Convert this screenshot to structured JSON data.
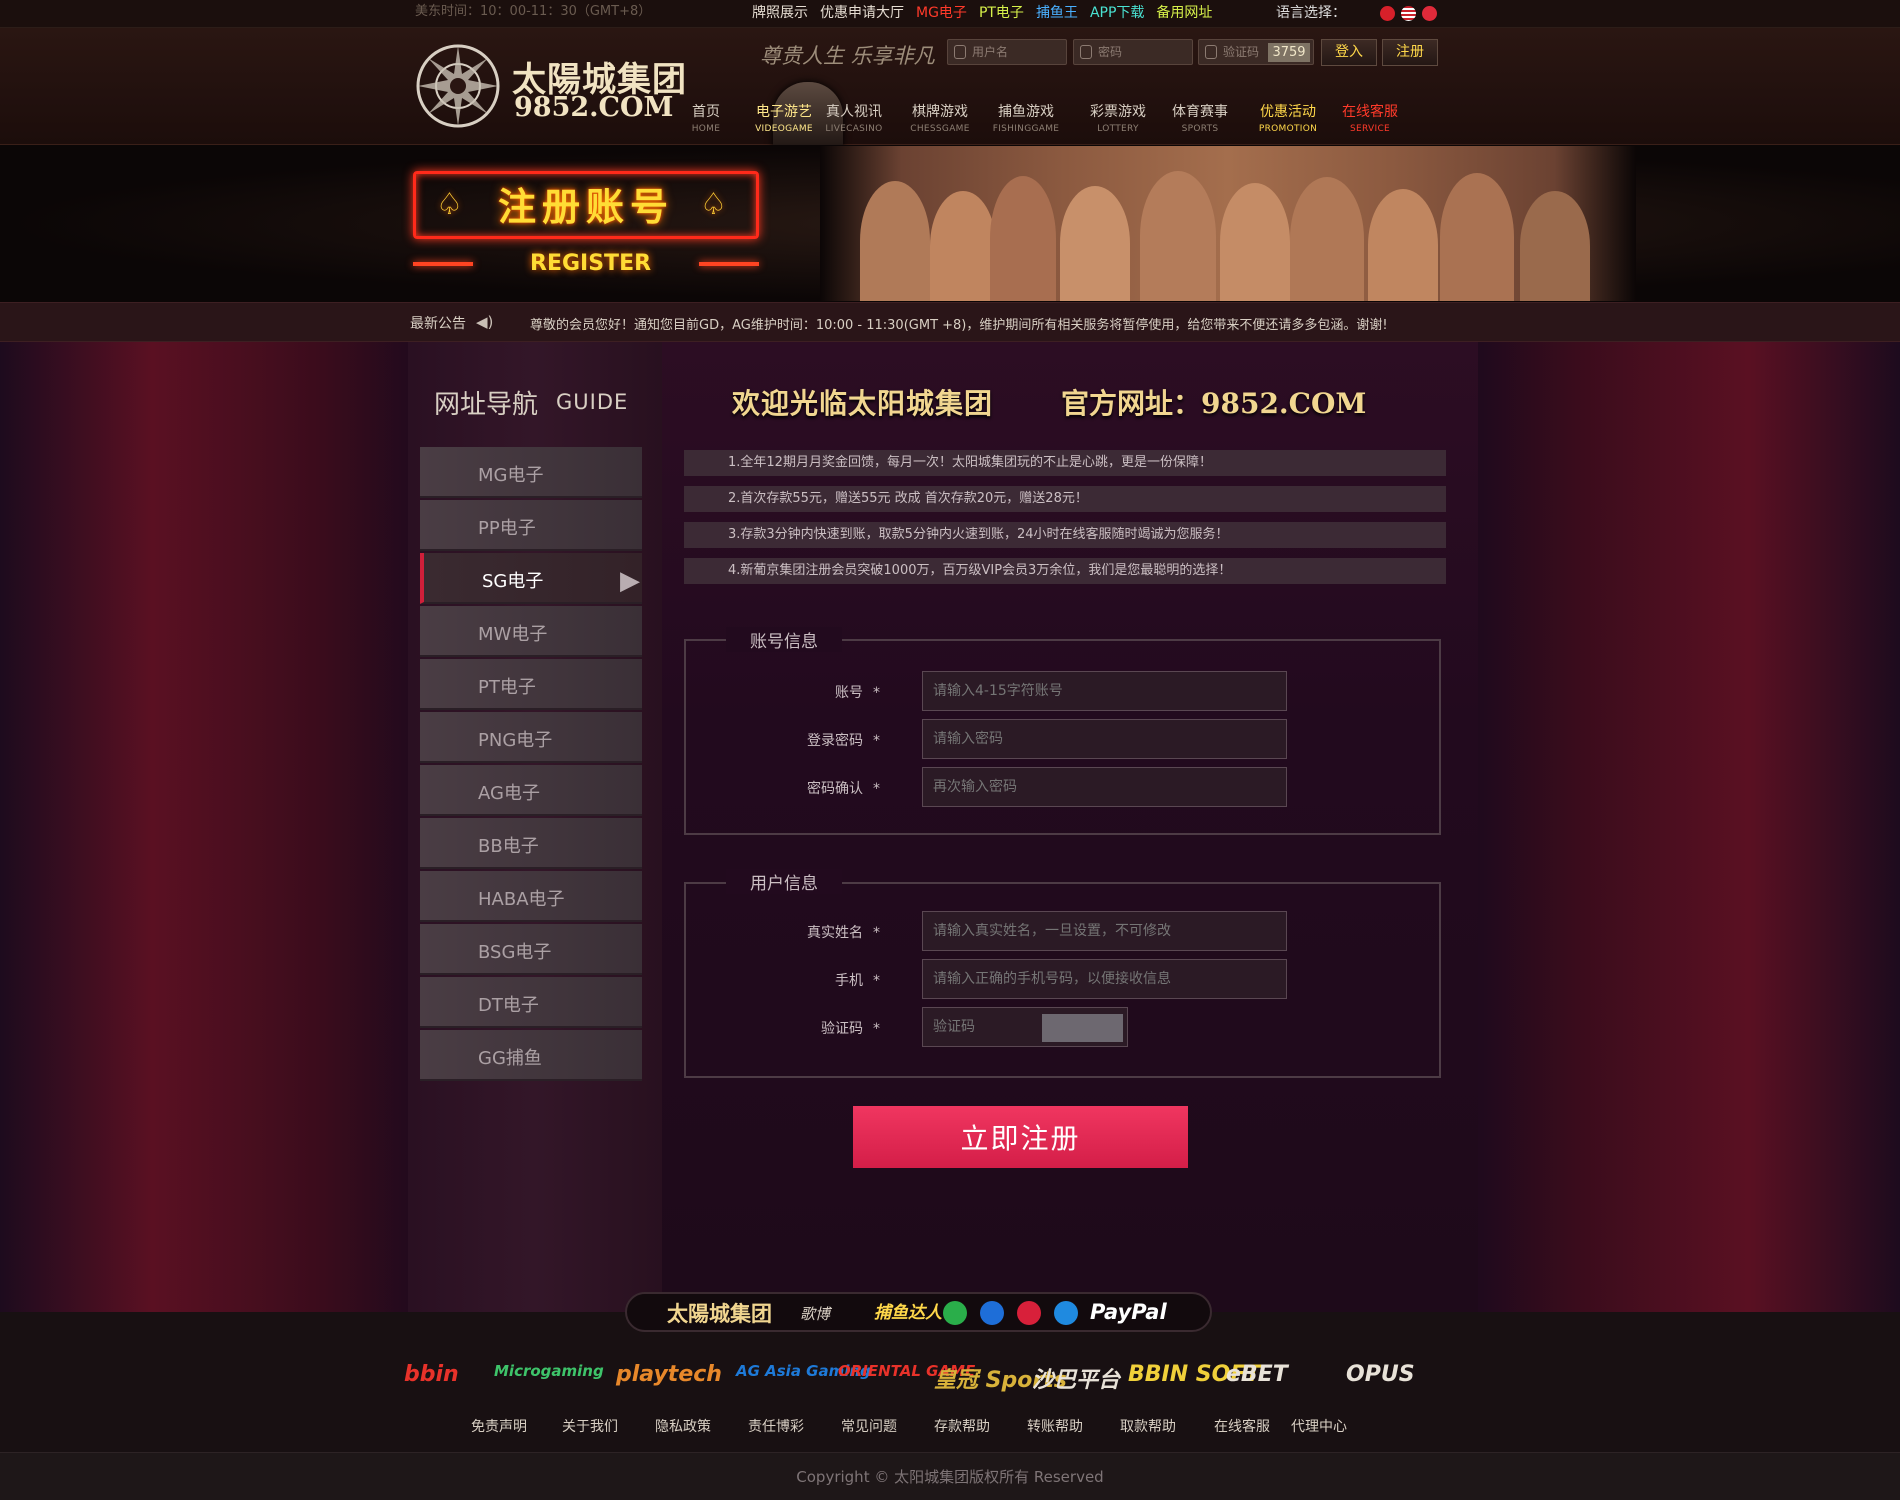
{
  "topbar": {
    "time": "美东时间：10：00-11：30（GMT+8）",
    "links": [
      {
        "label": "牌照展示",
        "color": "#e6ddd2"
      },
      {
        "label": "优惠申请大厅",
        "color": "#e6ddd2"
      },
      {
        "label": "MG电子",
        "color": "#ff3a2a"
      },
      {
        "label": "PT电子",
        "color": "#d6f04a"
      },
      {
        "label": "捕鱼王",
        "color": "#4ab0ff"
      },
      {
        "label": "APP下载",
        "color": "#4ae2d2"
      },
      {
        "label": "备用网址",
        "color": "#d6f04a"
      }
    ],
    "language_label": "语言选择："
  },
  "header": {
    "logo_cn": "太陽城集团",
    "logo_en": "9852.COM",
    "slogan": "尊贵人生 乐享非凡",
    "username_placeholder": "用户名",
    "password_placeholder": "密码",
    "captcha_placeholder": "验证码",
    "captcha_code": "3759",
    "login_label": "登入",
    "register_label": "注册"
  },
  "nav": [
    {
      "cn": "首页",
      "en": "HOME",
      "active": false
    },
    {
      "cn": "电子游艺",
      "en": "VIDEOGAME",
      "active": true
    },
    {
      "cn": "真人视讯",
      "en": "LIVECASINO",
      "active": false
    },
    {
      "cn": "棋牌游戏",
      "en": "CHESSGAME",
      "active": false
    },
    {
      "cn": "捕鱼游戏",
      "en": "FISHINGGAME",
      "active": false
    },
    {
      "cn": "彩票游戏",
      "en": "LOTTERY",
      "active": false
    },
    {
      "cn": "体育赛事",
      "en": "SPORTS",
      "active": false
    },
    {
      "cn": "优惠活动",
      "en": "PROMOTION",
      "active": false,
      "color": "#ffd84a"
    },
    {
      "cn": "在线客服",
      "en": "SERVICE",
      "active": false,
      "color": "#ff3a2a"
    }
  ],
  "banner": {
    "title": "注册账号",
    "subtitle": "REGISTER"
  },
  "notice": {
    "label": "最新公告",
    "text": "尊敬的会员您好！通知您目前GD，AG维护时间：10:00 - 11:30(GMT +8)，维护期间所有相关服务将暂停使用，给您带来不便还请多多包涵。谢谢!"
  },
  "sidebar": {
    "title_cn": "网址导航",
    "title_en": "GUIDE",
    "items": [
      {
        "label": "MG电子",
        "active": false
      },
      {
        "label": "PP电子",
        "active": false
      },
      {
        "label": "SG电子",
        "active": true
      },
      {
        "label": "MW电子",
        "active": false
      },
      {
        "label": "PT电子",
        "active": false
      },
      {
        "label": "PNG电子",
        "active": false
      },
      {
        "label": "AG电子",
        "active": false
      },
      {
        "label": "BB电子",
        "active": false
      },
      {
        "label": "HABA电子",
        "active": false
      },
      {
        "label": "BSG电子",
        "active": false
      },
      {
        "label": "DT电子",
        "active": false
      },
      {
        "label": "GG捕鱼",
        "active": false
      }
    ]
  },
  "main": {
    "welcome": "欢迎光临太阳城集团",
    "official": "官方网址：9852.COM",
    "rules": [
      "1.全年12期月月奖金回馈，每月一次！太阳城集团玩的不止是心跳，更是一份保障！",
      "2.首次存款55元，赠送55元    改成    首次存款20元，赠送28元！",
      "3.存款3分钟内快速到账，取款5分钟内火速到账，24小时在线客服随时竭诚为您服务！",
      "4.新葡京集团注册会员突破1000万，百万级VIP会员3万余位，我们是您最聪明的选择！"
    ],
    "account_section": {
      "legend": "账号信息",
      "fields": [
        {
          "label": "账号",
          "placeholder": "请输入4-15字符账号"
        },
        {
          "label": "登录密码",
          "placeholder": "请输入密码"
        },
        {
          "label": "密码确认",
          "placeholder": "再次输入密码"
        }
      ]
    },
    "user_section": {
      "legend": "用户信息",
      "fields": [
        {
          "label": "真实姓名",
          "placeholder": "请输入真实姓名，一旦设置，不可修改"
        },
        {
          "label": "手机",
          "placeholder": "请输入正确的手机号码，以便接收信息"
        },
        {
          "label": "验证码",
          "placeholder": "验证码"
        }
      ]
    },
    "required_mark": "*",
    "submit_label": "立即注册"
  },
  "payments": {
    "brand": "太陽城集团",
    "alibet": "歌博",
    "fishing": "捕鱼达人",
    "circles": [
      {
        "icon": "wechat-icon",
        "color": "#2aae4a"
      },
      {
        "icon": "qq-wallet-icon",
        "color": "#1e6ed8"
      },
      {
        "icon": "unionpay-icon",
        "color": "#d8203a"
      },
      {
        "icon": "alipay-icon",
        "color": "#1f8ae0"
      }
    ],
    "paypal": "PayPal"
  },
  "partners": [
    {
      "name": "bbin",
      "color": "#e8322a"
    },
    {
      "name": "Microgaming",
      "color": "#3ec46a"
    },
    {
      "name": "playtech",
      "color": "#e8882a"
    },
    {
      "name": "AG Asia Gaming",
      "color": "#1e7ad8"
    },
    {
      "name": "ORIENTAL GAME",
      "color": "#e8322a"
    },
    {
      "name": "皇冠 Sports",
      "color": "#d8b23a"
    },
    {
      "name": "沙巴平台",
      "color": "#e8e2d8"
    },
    {
      "name": "BBIN SOFT",
      "color": "#f0d03a"
    },
    {
      "name": "eBET",
      "color": "#e8e2d8"
    },
    {
      "name": "OPUS",
      "color": "#e8e2d8"
    }
  ],
  "footer_links": [
    "免责声明",
    "关于我们",
    "隐私政策",
    "责任博彩",
    "常见问题",
    "存款帮助",
    "转账帮助",
    "取款帮助",
    "在线客服",
    "代理中心"
  ],
  "copyright": "Copyright   ©   太阳城集团版权所有   Reserved"
}
